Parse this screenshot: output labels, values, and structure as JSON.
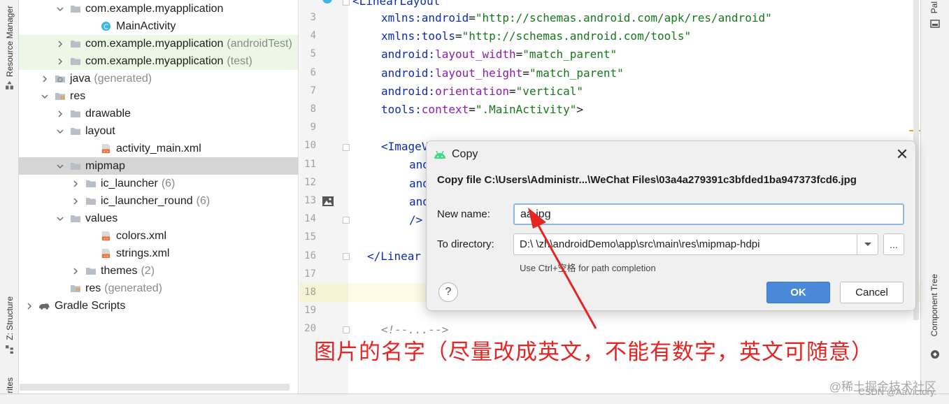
{
  "left_strip": {
    "resource_manager": "Resource Manager",
    "structure": "Z: Structure",
    "favorites": "orites"
  },
  "tree": {
    "rows": [
      {
        "label": "com.example.myapplication",
        "suffix": "",
        "icon": "folder-icon",
        "arrow": "down"
      },
      {
        "label": "MainActivity",
        "suffix": "",
        "icon": "class-icon",
        "arrow": "none"
      },
      {
        "label": "com.example.myapplication",
        "suffix": "(androidTest)",
        "icon": "folder-icon",
        "arrow": "right"
      },
      {
        "label": "com.example.myapplication",
        "suffix": "(test)",
        "icon": "folder-icon",
        "arrow": "right"
      },
      {
        "label": "java",
        "suffix": "(generated)",
        "icon": "folder-generated-icon",
        "arrow": "right"
      },
      {
        "label": "res",
        "suffix": "",
        "icon": "res-folder-icon",
        "arrow": "down"
      },
      {
        "label": "drawable",
        "suffix": "",
        "icon": "folder-icon",
        "arrow": "right"
      },
      {
        "label": "layout",
        "suffix": "",
        "icon": "folder-icon",
        "arrow": "down"
      },
      {
        "label": "activity_main.xml",
        "suffix": "",
        "icon": "xml-file-icon",
        "arrow": "none"
      },
      {
        "label": "mipmap",
        "suffix": "",
        "icon": "folder-icon",
        "arrow": "down"
      },
      {
        "label": "ic_launcher",
        "suffix": "(6)",
        "icon": "folder-icon",
        "arrow": "right"
      },
      {
        "label": "ic_launcher_round",
        "suffix": "(6)",
        "icon": "folder-icon",
        "arrow": "right"
      },
      {
        "label": "values",
        "suffix": "",
        "icon": "folder-icon",
        "arrow": "down"
      },
      {
        "label": "colors.xml",
        "suffix": "",
        "icon": "xml-file-icon",
        "arrow": "none"
      },
      {
        "label": "strings.xml",
        "suffix": "",
        "icon": "xml-file-icon",
        "arrow": "none"
      },
      {
        "label": "themes",
        "suffix": "(2)",
        "icon": "folder-icon",
        "arrow": "right"
      },
      {
        "label": "res",
        "suffix": "(generated)",
        "icon": "res-folder-icon",
        "arrow": "none"
      },
      {
        "label": "Gradle Scripts",
        "suffix": "",
        "icon": "gradle-icon",
        "arrow": "right"
      }
    ]
  },
  "editor": {
    "line_numbers": [
      "3",
      "4",
      "5",
      "6",
      "7",
      "8",
      "9",
      "10",
      "11",
      "12",
      "13",
      "14",
      "15",
      "16",
      "17",
      "18",
      "19",
      "20"
    ],
    "line2_text": "<LinearLayout",
    "xmlns_android": {
      "attr": "xmlns:android",
      "value": "\"http://schemas.android.com/apk/res/android\""
    },
    "xmlns_tools": {
      "attr": "xmlns:tools",
      "value": "\"http://schemas.android.com/tools\""
    },
    "layout_width": {
      "ns": "android:",
      "attr": "layout_width",
      "value": "\"match_parent\""
    },
    "layout_height": {
      "ns": "android:",
      "attr": "layout_height",
      "value": "\"match_parent\""
    },
    "orientation": {
      "ns": "android:",
      "attr": "orientation",
      "value": "\"vertical\""
    },
    "context": {
      "ns": "tools:",
      "attr": "context",
      "value": "\".MainActivity\"",
      "close": ">"
    },
    "imageview_open": "<ImageV",
    "and1": "and",
    "and2": "and",
    "and3": "and",
    "self_close": "/>",
    "linear_close": "</Linear",
    "comment": "<!--...-->"
  },
  "right_strip": {
    "palette": "Pal",
    "component_tree": "Component Tree"
  },
  "dialog": {
    "title": "Copy",
    "close_glyph": "✕",
    "copy_file_text": "Copy file C:\\Users\\Administr...\\WeChat Files\\03a4a279391c3bfded1ba947373fcd6.jpg",
    "new_name_label": "New name:",
    "new_name_value": "aa.jpg",
    "to_directory_label": "To directory:",
    "to_directory_value": "D:\\ \\zh\\androidDemo\\app\\src\\main\\res\\mipmap-hdpi",
    "browse_label": "...",
    "hint": "Use Ctrl+空格 for path completion",
    "help_glyph": "?",
    "ok_label": "OK",
    "cancel_label": "Cancel"
  },
  "annotation": {
    "text": "图片的名字（尽量改成英文，不能有数字，英文可随意）",
    "color": "#e62424"
  },
  "watermark": {
    "line1": "@稀土掘金技术社区",
    "line2": "CSDN @AaVictory."
  }
}
